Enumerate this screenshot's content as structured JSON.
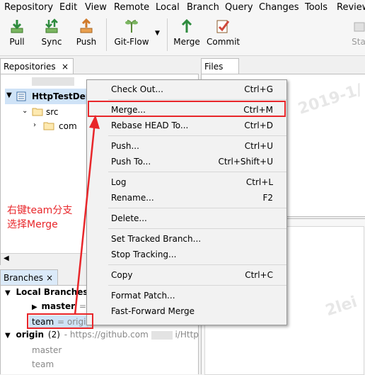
{
  "menu": [
    "Repository",
    "Edit",
    "View",
    "Remote",
    "Local",
    "Branch",
    "Query",
    "Changes",
    "Tools",
    "Review"
  ],
  "toolbar": {
    "pull": "Pull",
    "sync": "Sync",
    "push": "Push",
    "gitflow": "Git-Flow",
    "merge": "Merge",
    "commit": "Commit",
    "stash": "Sta"
  },
  "tabs": {
    "repositories": "Repositories",
    "files": "Files",
    "branches": "Branches",
    "close": "×"
  },
  "repo_tree": {
    "repo": "HttpTestDem",
    "src": "src",
    "com": "com"
  },
  "branches": {
    "local_branches": "Local Branches (",
    "master": "master",
    "master_suffix": "= c",
    "team": "team",
    "team_suffix": "= origin",
    "origin": "origin",
    "origin_count": "(2)",
    "origin_url_a": "- https://github.com",
    "origin_url_b": "i/Http",
    "remote_master": "master",
    "remote_team": "team"
  },
  "context_menu": [
    {
      "label": "Check Out...",
      "shortcut": "Ctrl+G"
    },
    {
      "label": "Merge...",
      "shortcut": "Ctrl+M"
    },
    {
      "label": "Rebase HEAD To...",
      "shortcut": "Ctrl+D"
    },
    {
      "label": "Push...",
      "shortcut": "Ctrl+U"
    },
    {
      "label": "Push To...",
      "shortcut": "Ctrl+Shift+U"
    },
    {
      "label": "Log",
      "shortcut": "Ctrl+L"
    },
    {
      "label": "Rename...",
      "shortcut": "F2"
    },
    {
      "label": "Delete...",
      "shortcut": ""
    },
    {
      "label": "Set Tracked Branch...",
      "shortcut": ""
    },
    {
      "label": "Stop Tracking...",
      "shortcut": ""
    },
    {
      "label": "Copy",
      "shortcut": "Ctrl+C"
    },
    {
      "label": "Format Patch...",
      "shortcut": ""
    },
    {
      "label": "Fast-Forward Merge",
      "shortcut": ""
    }
  ],
  "annotation": {
    "line1": "右键team分支",
    "line2": "选择Merge"
  },
  "watermark": {
    "w1": "2019-1/",
    "w2": "2le",
    "w3": "2lei"
  },
  "colors": {
    "accent": "#e8262a",
    "selection": "#cfe3f7",
    "tab_active": "#dbeaf9"
  }
}
